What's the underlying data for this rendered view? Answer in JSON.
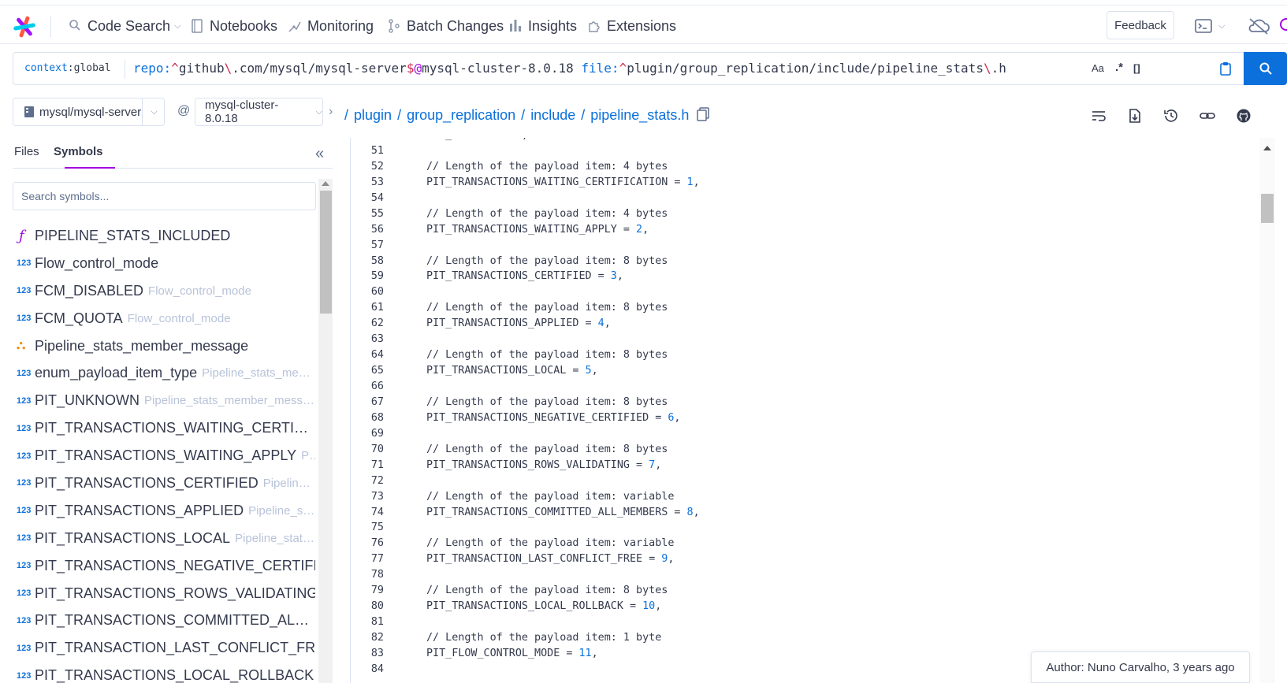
{
  "nav": {
    "items": [
      {
        "label": "Code Search",
        "icon": "search-icon"
      },
      {
        "label": "Notebooks",
        "icon": "notebook-icon"
      },
      {
        "label": "Monitoring",
        "icon": "monitoring-icon"
      },
      {
        "label": "Batch Changes",
        "icon": "batch-changes-icon"
      },
      {
        "label": "Insights",
        "icon": "insights-icon"
      },
      {
        "label": "Extensions",
        "icon": "puzzle-icon"
      }
    ],
    "feedback_label": "Feedback"
  },
  "search": {
    "context_key": "context",
    "context_value": "global",
    "query_parts": {
      "repo_key": "repo:",
      "repo_anchor": "^",
      "repo_a": "github",
      "repo_esc1": "\\",
      "repo_b": ".com/mysql/mysql-server",
      "repo_end": "$",
      "repo_at": "@",
      "repo_rev": "mysql-cluster-8.0.18",
      "file_key": "file:",
      "file_anchor": "^",
      "file_a": "plugin/group_replication/include/pipeline_stats",
      "file_esc": "\\",
      "file_b": ".h"
    },
    "case_toggle": "Aa",
    "regex_toggle": ".*",
    "structural_toggle": "[]"
  },
  "repo": {
    "name": "mysql/mysql-server",
    "at": "@",
    "revision": "mysql-cluster-8.0.18",
    "path": [
      "plugin",
      "group_replication",
      "include",
      "pipeline_stats.h"
    ]
  },
  "sidebar": {
    "tabs": [
      "Files",
      "Symbols"
    ],
    "active_tab": "Symbols",
    "search_placeholder": "Search symbols...",
    "symbols": [
      {
        "kind": "function",
        "name": "PIPELINE_STATS_INCLUDED",
        "context": ""
      },
      {
        "kind": "enum",
        "name": "Flow_control_mode",
        "context": ""
      },
      {
        "kind": "enum",
        "name": "FCM_DISABLED",
        "context": "Flow_control_mode"
      },
      {
        "kind": "enum",
        "name": "FCM_QUOTA",
        "context": "Flow_control_mode"
      },
      {
        "kind": "class",
        "name": "Pipeline_stats_member_message",
        "context": ""
      },
      {
        "kind": "enum",
        "name": "enum_payload_item_type",
        "context": "Pipeline_stats_memb..."
      },
      {
        "kind": "enum",
        "name": "PIT_UNKNOWN",
        "context": "Pipeline_stats_member_messag..."
      },
      {
        "kind": "enum",
        "name": "PIT_TRANSACTIONS_WAITING_CERTIFICATI...",
        "context": ""
      },
      {
        "kind": "enum",
        "name": "PIT_TRANSACTIONS_WAITING_APPLY",
        "context": "Pipelin..."
      },
      {
        "kind": "enum",
        "name": "PIT_TRANSACTIONS_CERTIFIED",
        "context": "Pipeline_stats..."
      },
      {
        "kind": "enum",
        "name": "PIT_TRANSACTIONS_APPLIED",
        "context": "Pipeline_stats_..."
      },
      {
        "kind": "enum",
        "name": "PIT_TRANSACTIONS_LOCAL",
        "context": "Pipeline_stats_me..."
      },
      {
        "kind": "enum",
        "name": "PIT_TRANSACTIONS_NEGATIVE_CERTIFIED",
        "context": "P..."
      },
      {
        "kind": "enum",
        "name": "PIT_TRANSACTIONS_ROWS_VALIDATING",
        "context": "Pi..."
      },
      {
        "kind": "enum",
        "name": "PIT_TRANSACTIONS_COMMITTED_ALL_ME...",
        "context": ""
      },
      {
        "kind": "enum",
        "name": "PIT_TRANSACTION_LAST_CONFLICT_FREE",
        "context": "Pi..."
      },
      {
        "kind": "enum",
        "name": "PIT_TRANSACTIONS_LOCAL_ROLLBACK",
        "context": "Pipe..."
      }
    ],
    "enum_icon_text": "123"
  },
  "code": {
    "lines": [
      {
        "n": "50",
        "text": "PIT_UNKNOWN = 0,",
        "num": ""
      },
      {
        "n": "51",
        "text": "",
        "num": ""
      },
      {
        "n": "52",
        "text": "// Length of the payload item: 4 bytes",
        "num": ""
      },
      {
        "n": "53",
        "text": "PIT_TRANSACTIONS_WAITING_CERTIFICATION = ",
        "num": "1"
      },
      {
        "n": "54",
        "text": "",
        "num": ""
      },
      {
        "n": "55",
        "text": "// Length of the payload item: 4 bytes",
        "num": ""
      },
      {
        "n": "56",
        "text": "PIT_TRANSACTIONS_WAITING_APPLY = ",
        "num": "2"
      },
      {
        "n": "57",
        "text": "",
        "num": ""
      },
      {
        "n": "58",
        "text": "// Length of the payload item: 8 bytes",
        "num": ""
      },
      {
        "n": "59",
        "text": "PIT_TRANSACTIONS_CERTIFIED = ",
        "num": "3"
      },
      {
        "n": "60",
        "text": "",
        "num": ""
      },
      {
        "n": "61",
        "text": "// Length of the payload item: 8 bytes",
        "num": ""
      },
      {
        "n": "62",
        "text": "PIT_TRANSACTIONS_APPLIED = ",
        "num": "4"
      },
      {
        "n": "63",
        "text": "",
        "num": ""
      },
      {
        "n": "64",
        "text": "// Length of the payload item: 8 bytes",
        "num": ""
      },
      {
        "n": "65",
        "text": "PIT_TRANSACTIONS_LOCAL = ",
        "num": "5"
      },
      {
        "n": "66",
        "text": "",
        "num": ""
      },
      {
        "n": "67",
        "text": "// Length of the payload item: 8 bytes",
        "num": ""
      },
      {
        "n": "68",
        "text": "PIT_TRANSACTIONS_NEGATIVE_CERTIFIED = ",
        "num": "6"
      },
      {
        "n": "69",
        "text": "",
        "num": ""
      },
      {
        "n": "70",
        "text": "// Length of the payload item: 8 bytes",
        "num": ""
      },
      {
        "n": "71",
        "text": "PIT_TRANSACTIONS_ROWS_VALIDATING = ",
        "num": "7"
      },
      {
        "n": "72",
        "text": "",
        "num": ""
      },
      {
        "n": "73",
        "text": "// Length of the payload item: variable",
        "num": ""
      },
      {
        "n": "74",
        "text": "PIT_TRANSACTIONS_COMMITTED_ALL_MEMBERS = ",
        "num": "8"
      },
      {
        "n": "75",
        "text": "",
        "num": ""
      },
      {
        "n": "76",
        "text": "// Length of the payload item: variable",
        "num": ""
      },
      {
        "n": "77",
        "text": "PIT_TRANSACTION_LAST_CONFLICT_FREE = ",
        "num": "9"
      },
      {
        "n": "78",
        "text": "",
        "num": ""
      },
      {
        "n": "79",
        "text": "// Length of the payload item: 8 bytes",
        "num": ""
      },
      {
        "n": "80",
        "text": "PIT_TRANSACTIONS_LOCAL_ROLLBACK = ",
        "num": "10"
      },
      {
        "n": "81",
        "text": "",
        "num": ""
      },
      {
        "n": "82",
        "text": "// Length of the payload item: 1 byte",
        "num": ""
      },
      {
        "n": "83",
        "text": "PIT_FLOW_CONTROL_MODE = ",
        "num": "11"
      },
      {
        "n": "84",
        "text": "",
        "num": ""
      }
    ],
    "author_label": "Author: Nuno Carvalho, 3 years ago"
  },
  "colors": {
    "accent": "#0b70db",
    "tab_underline": "#a305e1",
    "regex_red": "#d12d4e",
    "class_icon": "#f58c00"
  }
}
